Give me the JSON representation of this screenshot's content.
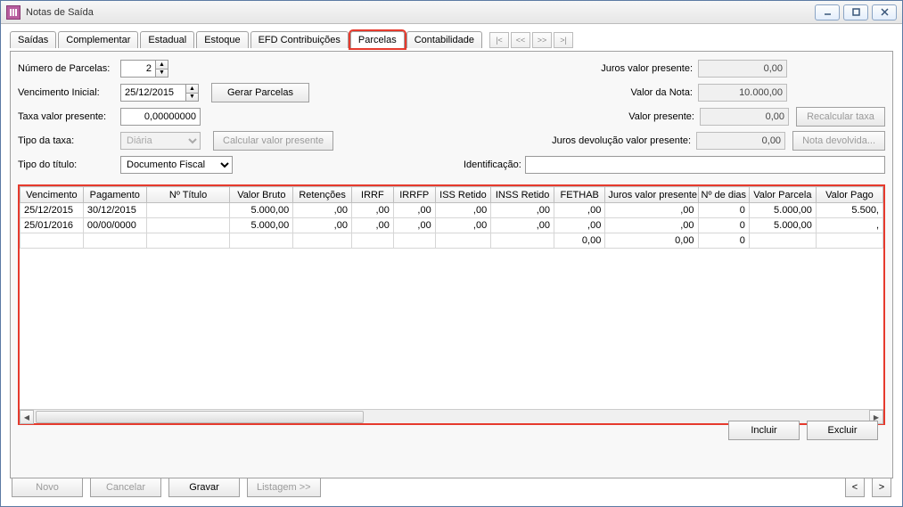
{
  "window": {
    "title": "Notas de Saída"
  },
  "tabs": {
    "items": [
      {
        "label": "Saídas"
      },
      {
        "label": "Complementar"
      },
      {
        "label": "Estadual"
      },
      {
        "label": "Estoque"
      },
      {
        "label": "EFD Contribuições"
      },
      {
        "label": "Parcelas",
        "active": true
      },
      {
        "label": "Contabilidade"
      }
    ]
  },
  "nav": {
    "first": "|<",
    "prev": "<<",
    "next": ">>",
    "last": ">|"
  },
  "form": {
    "numero_parcelas_label": "Número de Parcelas:",
    "numero_parcelas_value": "2",
    "vencimento_inicial_label": "Vencimento Inicial:",
    "vencimento_inicial_value": "25/12/2015",
    "gerar_parcelas": "Gerar Parcelas",
    "taxa_valor_presente_label": "Taxa valor presente:",
    "taxa_valor_presente_value": "0,00000000",
    "tipo_taxa_label": "Tipo da taxa:",
    "tipo_taxa_value": "Diária",
    "calcular_vp": "Calcular valor presente",
    "tipo_titulo_label": "Tipo do título:",
    "tipo_titulo_value": "Documento Fiscal",
    "identificacao_label": "Identificação:",
    "identificacao_value": "",
    "juros_vp_label": "Juros valor presente:",
    "juros_vp_value": "0,00",
    "valor_nota_label": "Valor da Nota:",
    "valor_nota_value": "10.000,00",
    "valor_presente_label": "Valor presente:",
    "valor_presente_value": "0,00",
    "juros_dev_vp_label": "Juros devolução valor presente:",
    "juros_dev_vp_value": "0,00",
    "recalcular_taxa": "Recalcular taxa",
    "nota_devolvida": "Nota devolvida..."
  },
  "grid": {
    "headers": [
      "Vencimento",
      "Pagamento",
      "Nº Título",
      "Valor Bruto",
      "Retenções",
      "IRRF",
      "IRRFP",
      "ISS Retido",
      "INSS Retido",
      "FETHAB",
      "Juros valor presente",
      "Nº de dias",
      "Valor Parcela",
      "Valor Pago"
    ],
    "rows": [
      {
        "vencimento": "25/12/2015",
        "pagamento": "30/12/2015",
        "n_titulo": "",
        "valor_bruto": "5.000,00",
        "retencoes": ",00",
        "irrf": ",00",
        "irrfp": ",00",
        "iss_retido": ",00",
        "inss_retido": ",00",
        "fethab": ",00",
        "juros_vp": ",00",
        "n_dias": "0",
        "valor_parcela": "5.000,00",
        "valor_pago": "5.500,"
      },
      {
        "vencimento": "25/01/2016",
        "pagamento": "00/00/0000",
        "n_titulo": "",
        "valor_bruto": "5.000,00",
        "retencoes": ",00",
        "irrf": ",00",
        "irrfp": ",00",
        "iss_retido": ",00",
        "inss_retido": ",00",
        "fethab": ",00",
        "juros_vp": ",00",
        "n_dias": "0",
        "valor_parcela": "5.000,00",
        "valor_pago": ","
      }
    ],
    "totals": {
      "fethab": "0,00",
      "juros_vp": "0,00",
      "n_dias": "0"
    }
  },
  "panel_actions": {
    "incluir": "Incluir",
    "excluir": "Excluir"
  },
  "footer": {
    "novo": "Novo",
    "cancelar": "Cancelar",
    "gravar": "Gravar",
    "listagem": "Listagem >>",
    "prev": "<",
    "next": ">"
  }
}
